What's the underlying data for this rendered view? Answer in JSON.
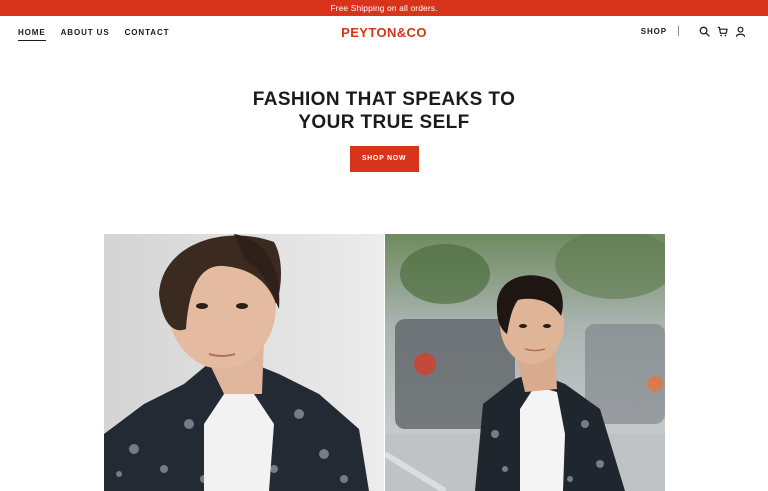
{
  "announcement": "Free Shipping on all orders.",
  "nav": {
    "links": [
      "Home",
      "About Us",
      "Contact"
    ],
    "active_index": 0
  },
  "brand": {
    "logo": "PEYTON&CO"
  },
  "nav_right": {
    "shop_label": "SHOP",
    "icons": [
      "search-icon",
      "cart-icon",
      "account-icon"
    ]
  },
  "hero": {
    "title_line1": "FASHION THAT SPEAKS TO",
    "title_line2": "YOUR TRUE SELF",
    "button_label": "SHOP NOW"
  },
  "colors": {
    "accent": "#d8341c",
    "text": "#1b1b1b",
    "background": "#ffffff"
  }
}
